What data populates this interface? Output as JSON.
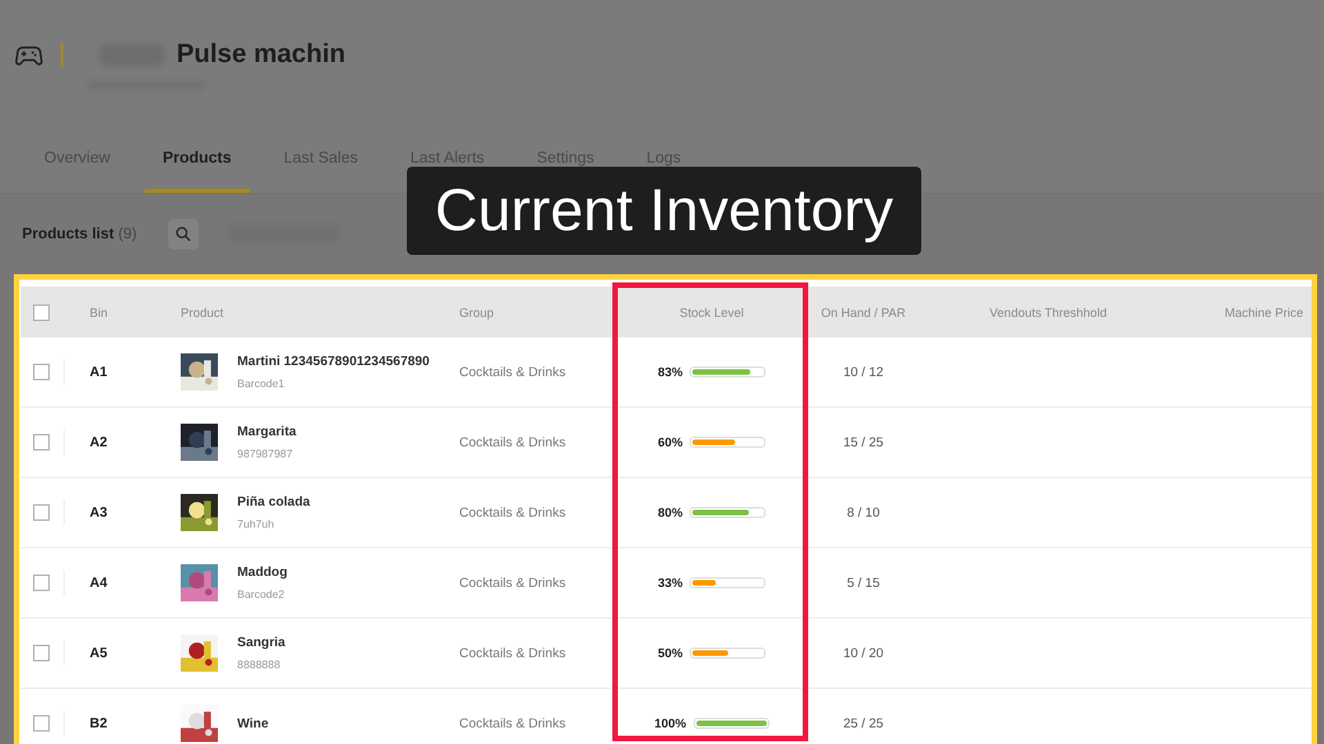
{
  "header": {
    "title": "Pulse machin"
  },
  "tabs": [
    {
      "label": "Overview",
      "selected": false
    },
    {
      "label": "Products",
      "selected": true
    },
    {
      "label": "Last Sales",
      "selected": false
    },
    {
      "label": "Last Alerts",
      "selected": false
    },
    {
      "label": "Settings",
      "selected": false
    },
    {
      "label": "Logs",
      "selected": false
    }
  ],
  "products_list": {
    "label": "Products list",
    "count": "(9)"
  },
  "table": {
    "columns": [
      "Bin",
      "Product",
      "Group",
      "Stock Level",
      "On Hand / PAR",
      "Vendouts Threshhold",
      "Machine Price"
    ],
    "select_all": {
      "checked": false
    },
    "rows": [
      {
        "checked": false,
        "bin": "A1",
        "product": "Martini 12345678901234567890",
        "code": "Barcode1",
        "group": "Cocktails & Drinks",
        "stock": "83%",
        "level": 0.83,
        "color": "#7cc242",
        "on_hand": "10 / 12"
      },
      {
        "checked": false,
        "bin": "A2",
        "product": "Margarita",
        "code": "987987987",
        "group": "Cocktails & Drinks",
        "stock": "60%",
        "level": 0.6,
        "color": "#ff9800",
        "on_hand": "15 / 25"
      },
      {
        "checked": false,
        "bin": "A3",
        "product": "Piña colada",
        "code": "7uh7uh",
        "group": "Cocktails & Drinks",
        "stock": "80%",
        "level": 0.8,
        "color": "#7cc242",
        "on_hand": "8 / 10"
      },
      {
        "checked": false,
        "bin": "A4",
        "product": "Maddog",
        "code": "Barcode2",
        "group": "Cocktails & Drinks",
        "stock": "33%",
        "level": 0.33,
        "color": "#ff9800",
        "on_hand": "5 / 15"
      },
      {
        "checked": false,
        "bin": "A5",
        "product": "Sangria",
        "code": "8888888",
        "group": "Cocktails & Drinks",
        "stock": "50%",
        "level": 0.5,
        "color": "#ff9800",
        "on_hand": "10 / 20"
      },
      {
        "checked": false,
        "bin": "B2",
        "product": "Wine",
        "group": "Cocktails & Drinks",
        "stock": "100%",
        "level": 1,
        "color": "#7cc242",
        "on_hand": "25 / 25"
      }
    ]
  },
  "caption": {
    "text": "Current Inventory"
  }
}
